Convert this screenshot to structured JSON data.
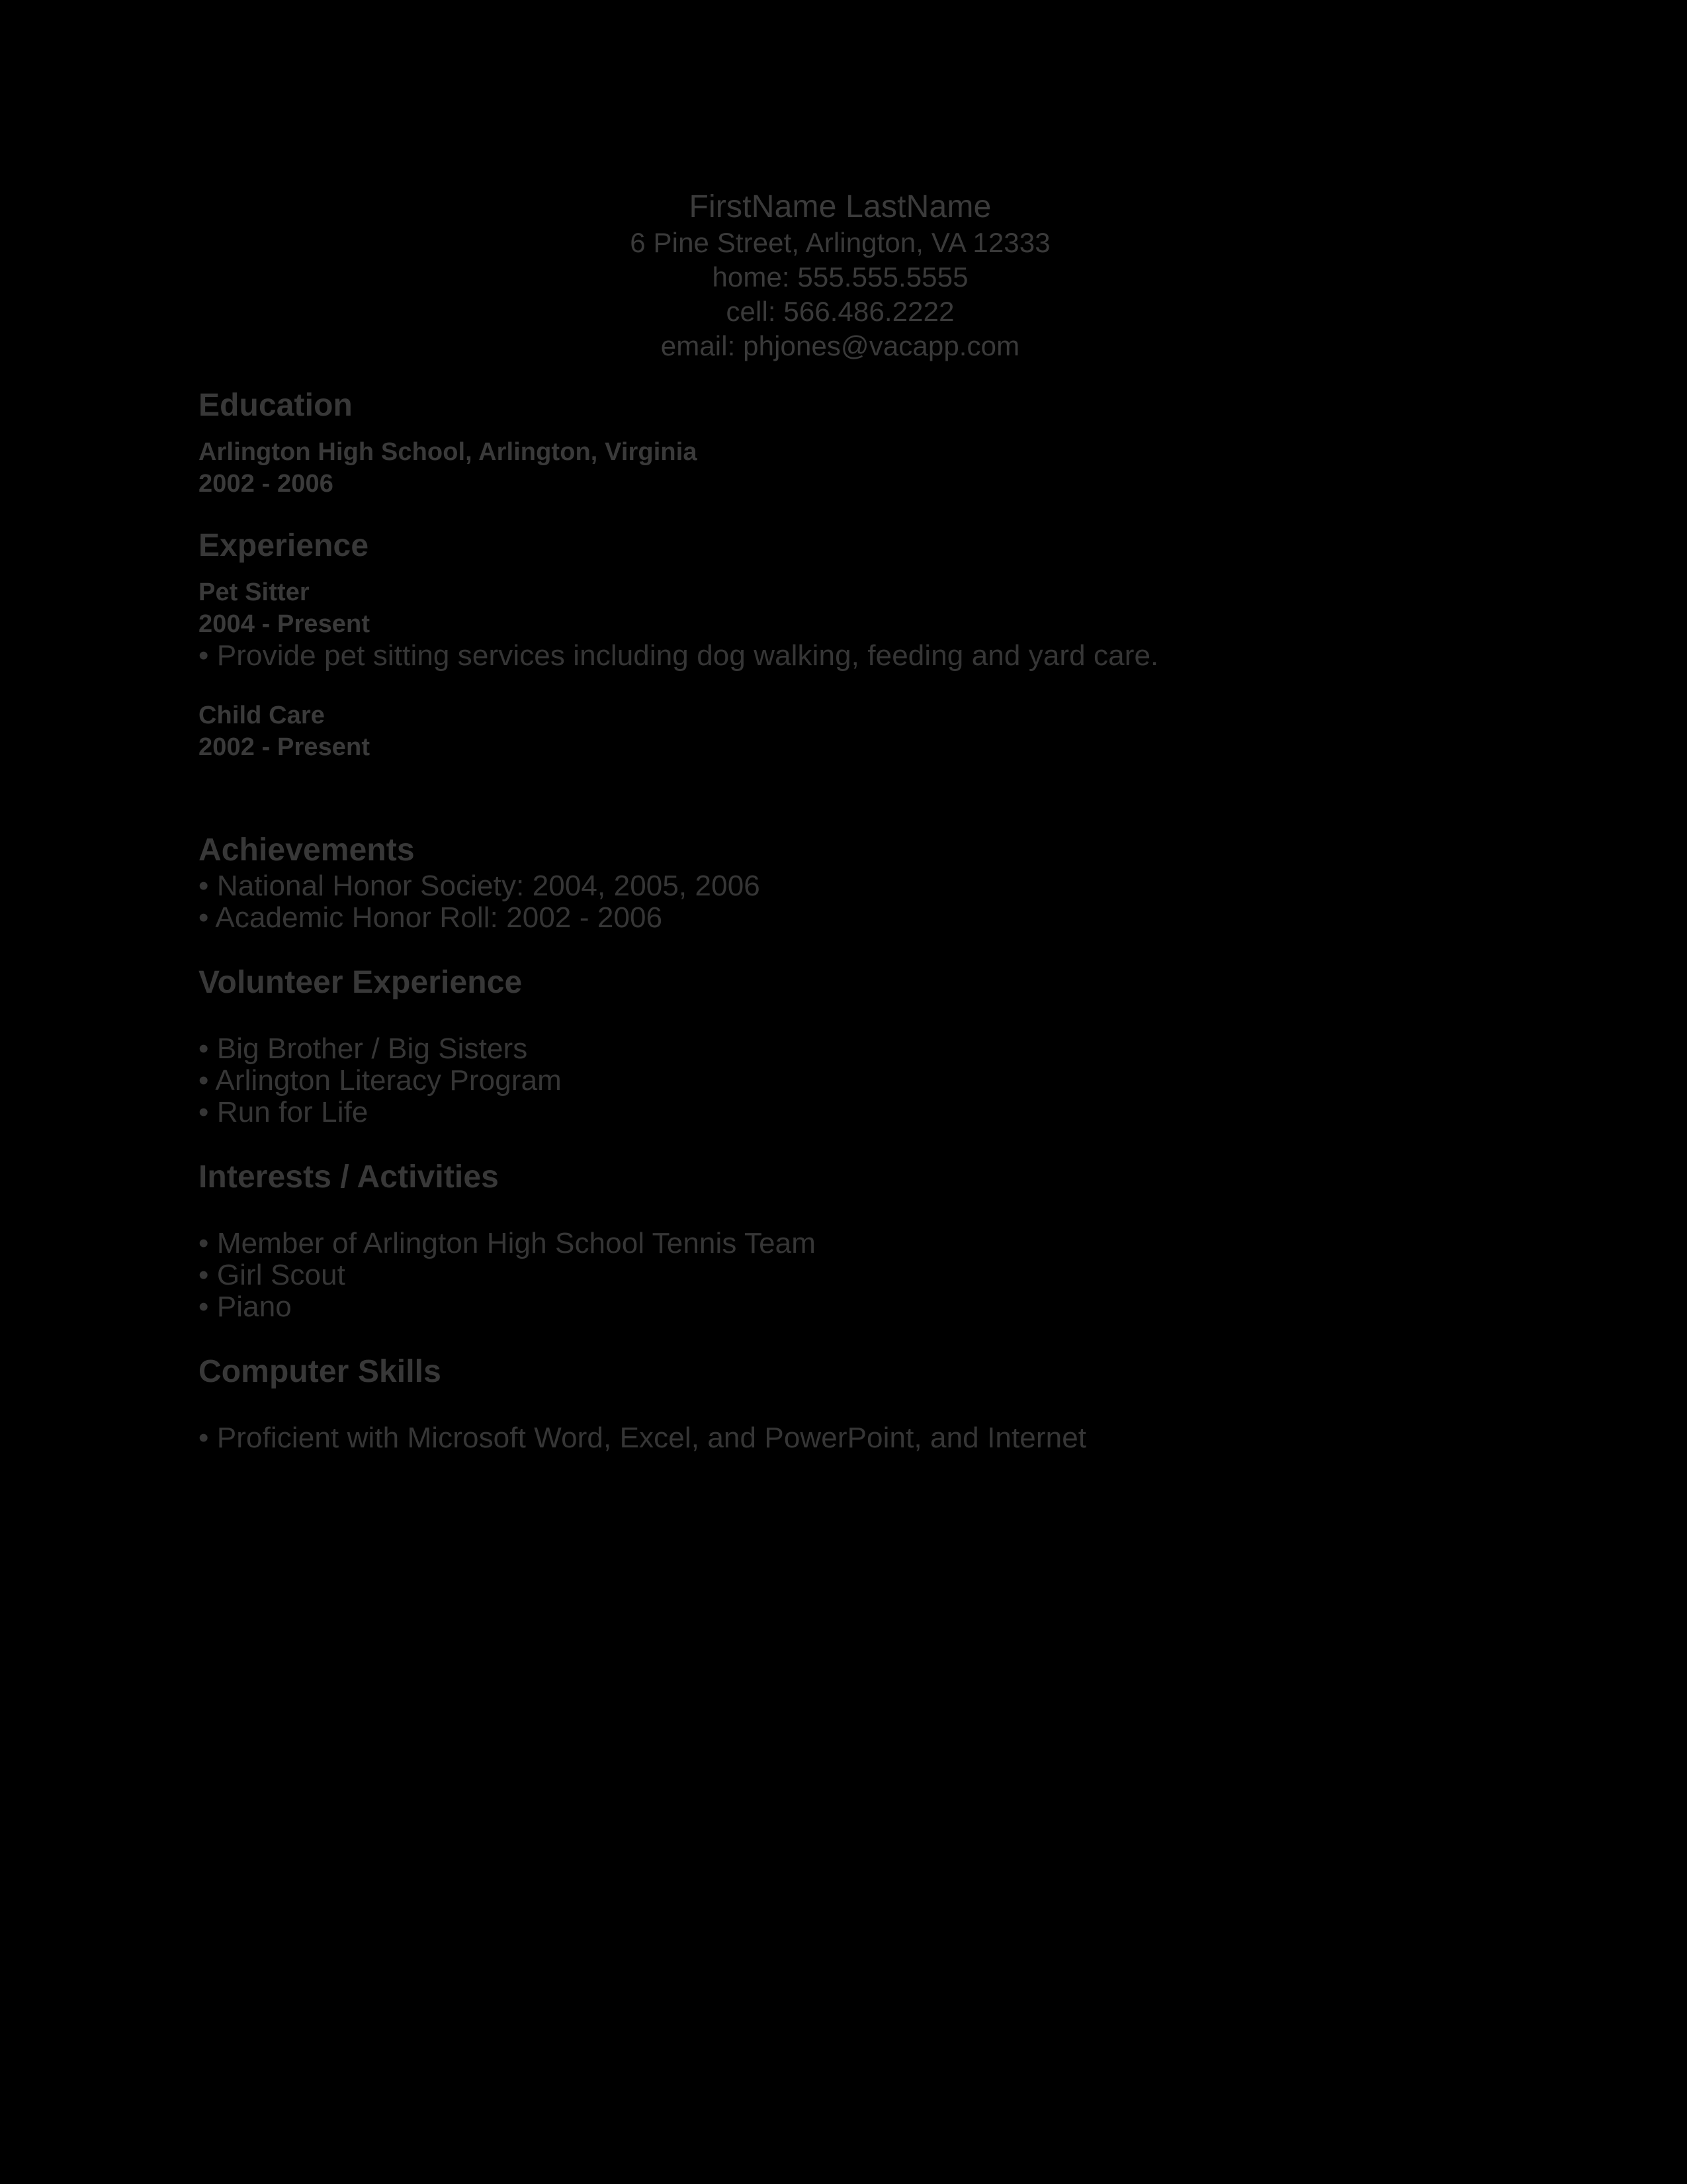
{
  "document": {
    "type": "resume",
    "background_color": "#000000",
    "text_color": "#383838"
  },
  "header": {
    "name": "FirstName LastName",
    "address": "6 Pine Street, Arlington, VA 12333",
    "home_phone": "home: 555.555.5555",
    "cell_phone": "cell: 566.486.2222",
    "email": "email: phjones@vacapp.com"
  },
  "education": {
    "heading": "Education",
    "school": "Arlington High School, Arlington, Virginia",
    "dates": "2002 - 2006"
  },
  "experience": {
    "heading": "Experience",
    "entries": [
      {
        "title": "Pet Sitter",
        "dates": "2004 - Present",
        "bullets": [
          "• Provide pet sitting services including dog walking, feeding and yard care."
        ]
      },
      {
        "title": "Child Care",
        "dates": "2002 - Present",
        "bullets": []
      }
    ]
  },
  "achievements": {
    "heading": "Achievements",
    "bullets": [
      "• National Honor Society: 2004, 2005, 2006",
      "• Academic Honor Roll: 2002 - 2006"
    ]
  },
  "volunteer_experience": {
    "heading": "Volunteer Experience",
    "bullets": [
      "• Big Brother / Big Sisters",
      "• Arlington Literacy Program",
      "• Run for Life"
    ]
  },
  "interests_activities": {
    "heading": "Interests / Activities",
    "bullets": [
      "• Member of Arlington High School Tennis Team",
      "• Girl Scout",
      "• Piano"
    ]
  },
  "computer_skills": {
    "heading": "Computer Skills",
    "bullets": [
      "• Proficient with Microsoft Word, Excel, and PowerPoint, and Internet"
    ]
  }
}
